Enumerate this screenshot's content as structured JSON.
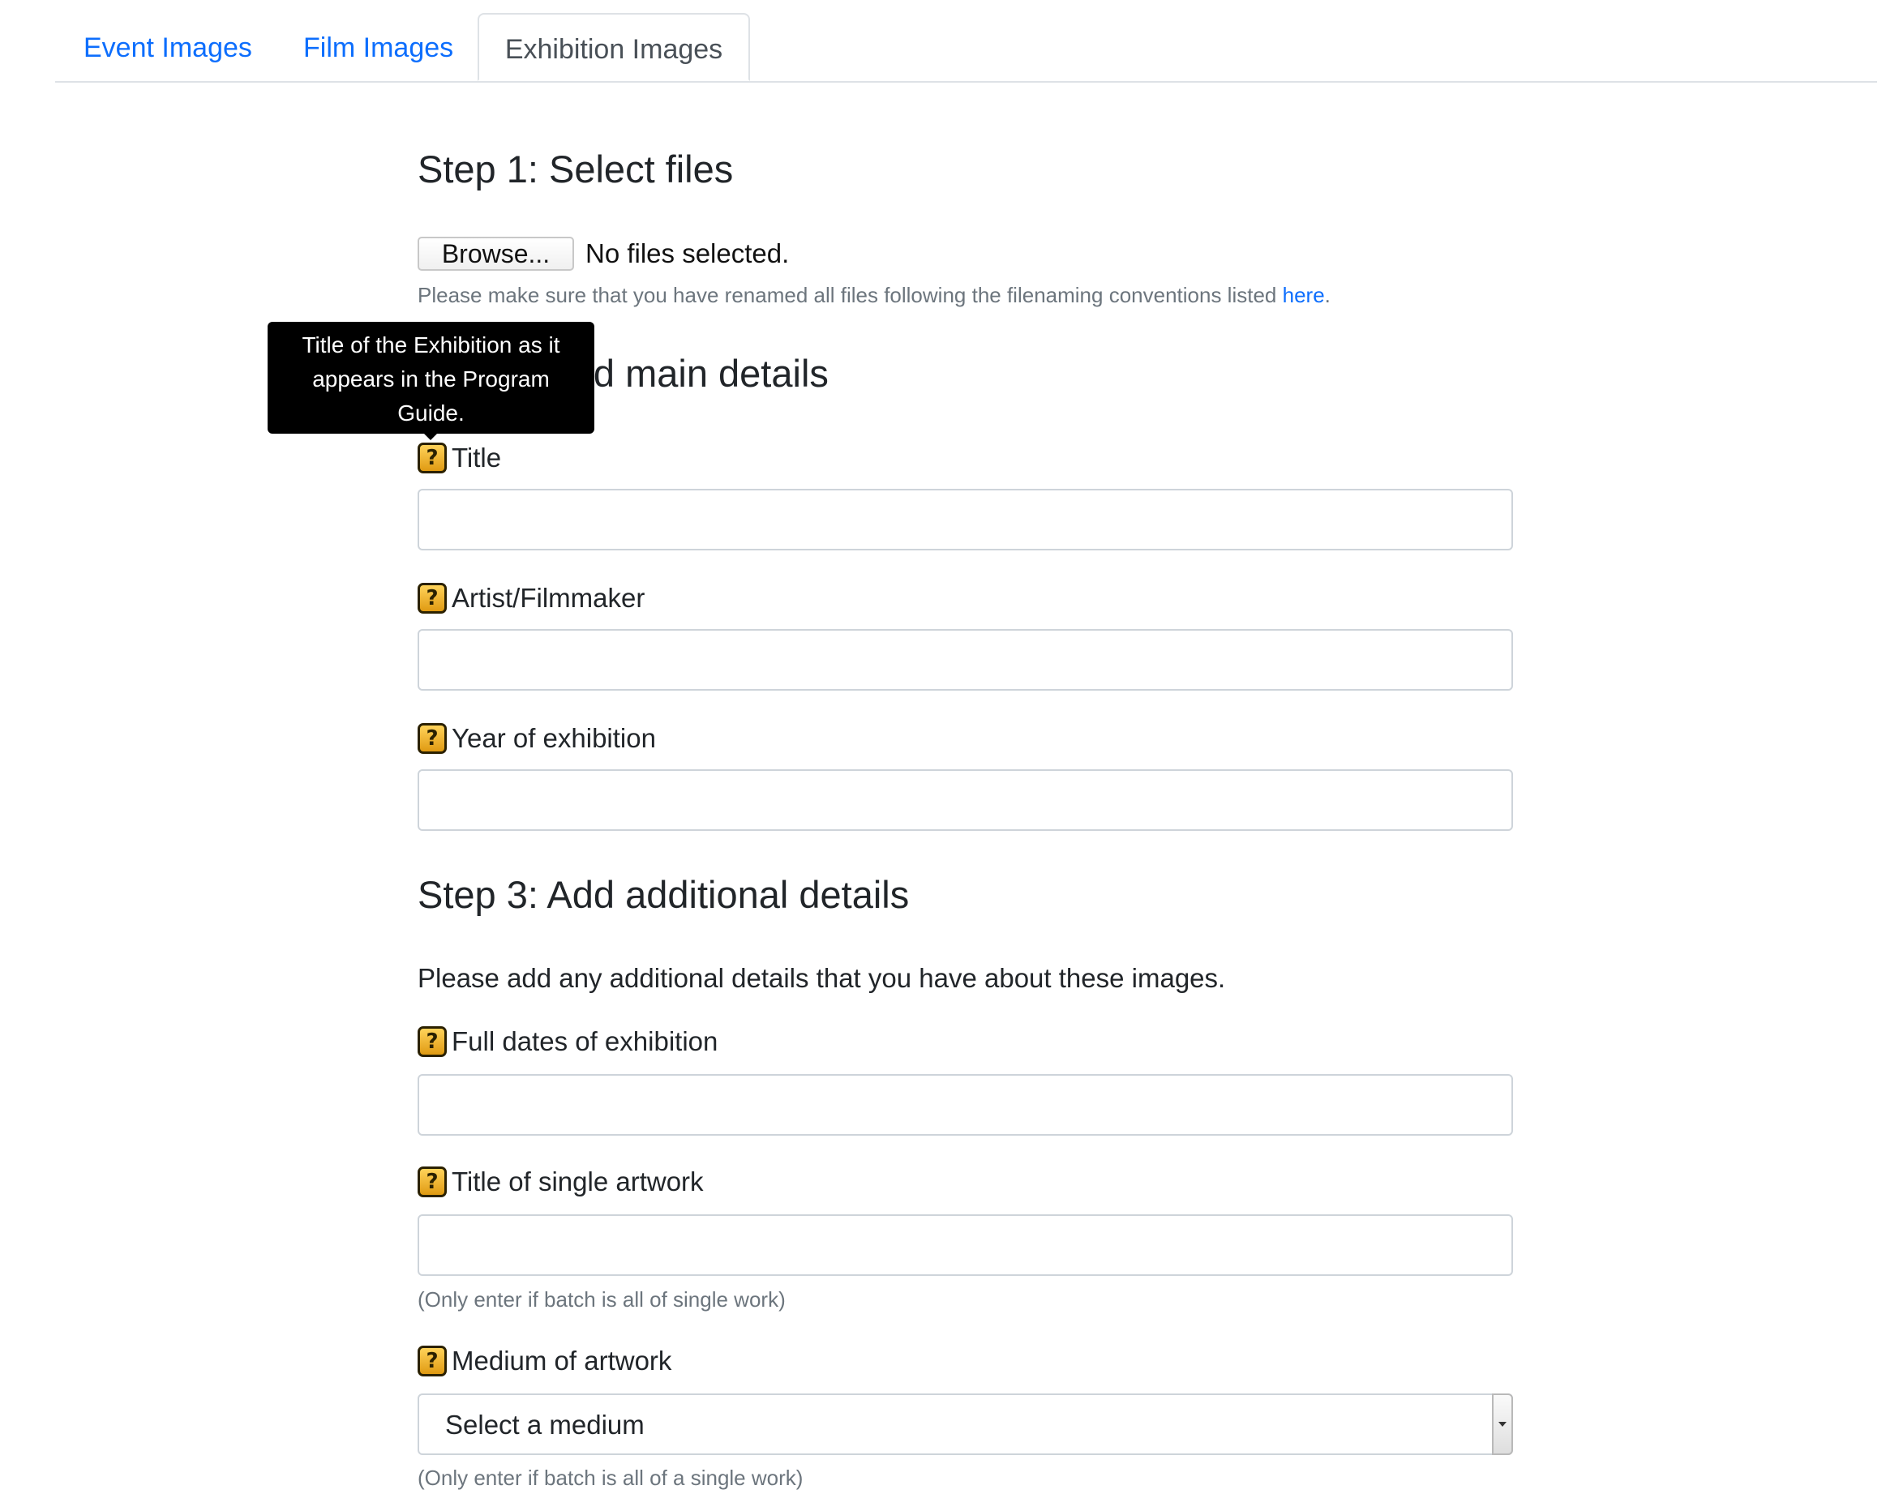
{
  "tabs": [
    {
      "label": "Event Images",
      "active": false
    },
    {
      "label": "Film Images",
      "active": false
    },
    {
      "label": "Exhibition Images",
      "active": true
    }
  ],
  "step1": {
    "heading": "Step 1: Select files",
    "browse_label": "Browse...",
    "file_status": "No files selected.",
    "note_prefix": "Please make sure that you have renamed all files following the filenaming conventions listed ",
    "note_link": "here",
    "note_suffix": "."
  },
  "step2": {
    "heading": "Step 2: Add main details",
    "fields": [
      {
        "label": "Title",
        "value": ""
      },
      {
        "label": "Artist/Filmmaker",
        "value": ""
      },
      {
        "label": "Year of exhibition",
        "value": ""
      }
    ]
  },
  "tooltip": {
    "text": "Title of the Exhibition as it appears in the Program Guide."
  },
  "step3": {
    "heading": "Step 3: Add additional details",
    "intro": "Please add any additional details that you have about these images.",
    "fields": [
      {
        "label": "Full dates of exhibition",
        "value": "",
        "hint": ""
      },
      {
        "label": "Title of single artwork",
        "value": "",
        "hint": "(Only enter if batch is all of single work)"
      }
    ],
    "medium": {
      "label": "Medium of artwork",
      "selected": "Select a medium",
      "hint": "(Only enter if batch is all of a single work)"
    }
  },
  "icons": {
    "help": "help-question-icon",
    "help_glyph": "?"
  },
  "colors": {
    "link": "#0d6efd",
    "tooltip_bg": "#000000",
    "help_icon": "#f0b429",
    "muted_text": "#6c757d"
  }
}
